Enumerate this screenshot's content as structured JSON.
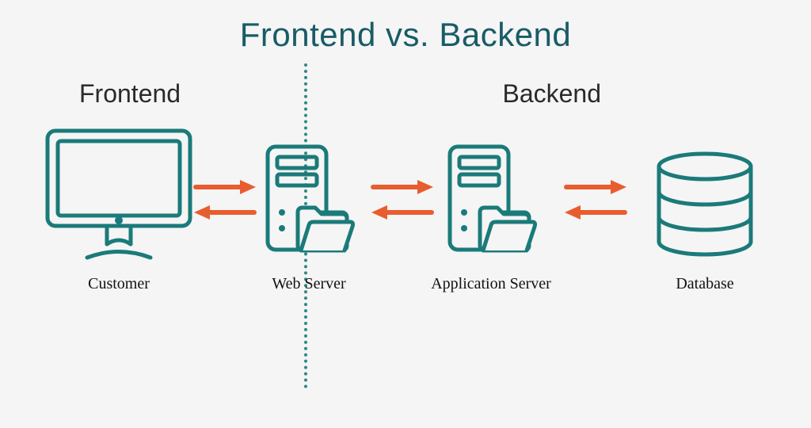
{
  "title": "Frontend vs. Backend",
  "sections": {
    "frontend": "Frontend",
    "backend": "Backend"
  },
  "nodes": {
    "customer": {
      "label": "Customer",
      "icon": "monitor-icon"
    },
    "web": {
      "label": "Web Server",
      "icon": "server-folder-icon"
    },
    "app": {
      "label": "Application Server",
      "icon": "server-folder-icon"
    },
    "db": {
      "label": "Database",
      "icon": "database-icon"
    }
  },
  "colors": {
    "teal": "#1b7a7a",
    "orange": "#e85d2f",
    "background": "#f4f5f4"
  }
}
